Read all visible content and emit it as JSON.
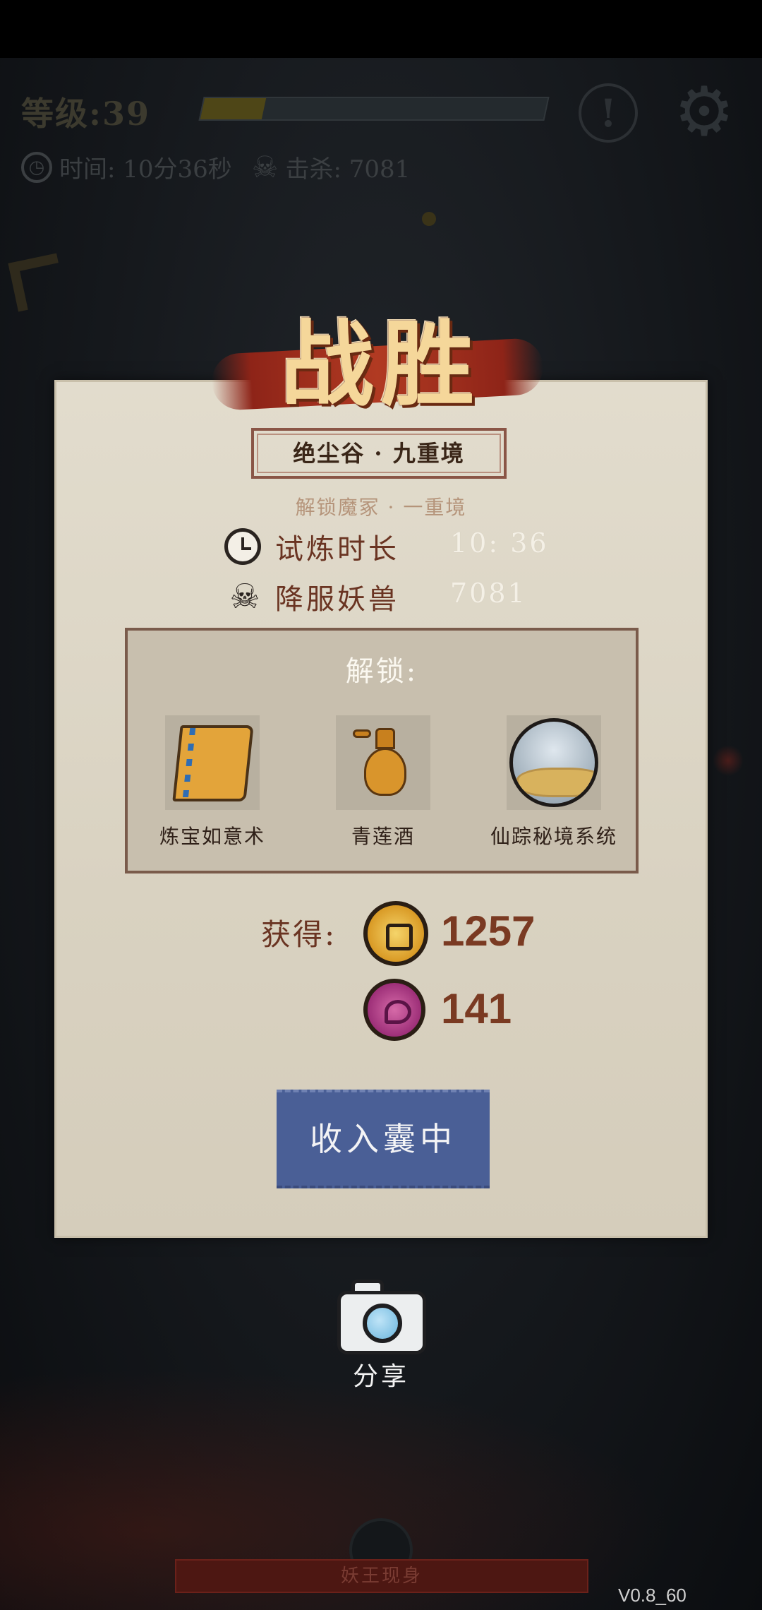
{
  "hud": {
    "level_text": "等级:39",
    "xp_progress": 0.18,
    "time_text": "时间: 10分36秒",
    "kills_text": "击杀: 7081",
    "alert_icon": "exclamation-icon",
    "settings_icon": "gear-icon"
  },
  "result": {
    "title": "战胜",
    "stage_name": "绝尘谷 · 九重境",
    "unlock_hint": "解锁魔冢 · 一重境",
    "duration_label": "试炼时长",
    "duration_value": "10: 36",
    "kills_label": "降服妖兽",
    "kills_value": "7081",
    "unlock_title": "解锁:",
    "unlocked_items": [
      {
        "name": "炼宝如意术",
        "icon": "book-icon"
      },
      {
        "name": "青莲酒",
        "icon": "wine-jug-icon"
      },
      {
        "name": "仙踪秘境系统",
        "icon": "realm-icon"
      }
    ],
    "gain_label": "获得:",
    "rewards": [
      {
        "icon": "copper-coin-icon",
        "amount": "1257"
      },
      {
        "icon": "purple-orb-icon",
        "amount": "141"
      }
    ],
    "collect_button": "收入囊中"
  },
  "share": {
    "label": "分享",
    "icon": "camera-icon"
  },
  "bottom": {
    "boss_text": "妖王现身",
    "version": "V0.8_60"
  },
  "colors": {
    "panel": "#ddd6c6",
    "button": "#4a5f96",
    "title": "#f5d79a",
    "banner": "#b13a22",
    "text_brown": "#6a3422"
  }
}
